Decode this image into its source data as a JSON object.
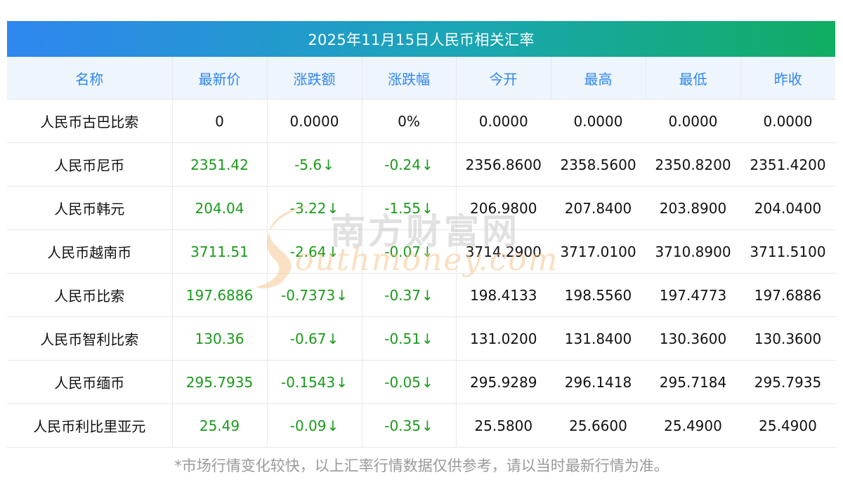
{
  "title": "2025年11月15日人民币相关汇率",
  "columns": [
    "名称",
    "最新价",
    "涨跌额",
    "涨跌幅",
    "今开",
    "最高",
    "最低",
    "昨收"
  ],
  "rows": [
    {
      "name": "人民币古巴比索",
      "latest": "0",
      "change": "0.0000",
      "pct": "0%",
      "open": "0.0000",
      "high": "0.0000",
      "low": "0.0000",
      "prev": "0.0000",
      "down": false
    },
    {
      "name": "人民币尼币",
      "latest": "2351.42",
      "change": "-5.6",
      "pct": "-0.24",
      "open": "2356.8600",
      "high": "2358.5600",
      "low": "2350.8200",
      "prev": "2351.4200",
      "down": true
    },
    {
      "name": "人民币韩元",
      "latest": "204.04",
      "change": "-3.22",
      "pct": "-1.55",
      "open": "206.9800",
      "high": "207.8400",
      "low": "203.8900",
      "prev": "204.0400",
      "down": true
    },
    {
      "name": "人民币越南币",
      "latest": "3711.51",
      "change": "-2.64",
      "pct": "-0.07",
      "open": "3714.2900",
      "high": "3717.0100",
      "low": "3710.8900",
      "prev": "3711.5100",
      "down": true
    },
    {
      "name": "人民币比索",
      "latest": "197.6886",
      "change": "-0.7373",
      "pct": "-0.37",
      "open": "198.4133",
      "high": "198.5560",
      "low": "197.4773",
      "prev": "197.6886",
      "down": true
    },
    {
      "name": "人民币智利比索",
      "latest": "130.36",
      "change": "-0.67",
      "pct": "-0.51",
      "open": "131.0200",
      "high": "131.8400",
      "low": "130.3600",
      "prev": "130.3600",
      "down": true
    },
    {
      "name": "人民币缅币",
      "latest": "295.7935",
      "change": "-0.1543",
      "pct": "-0.05",
      "open": "295.9289",
      "high": "296.1418",
      "low": "295.7184",
      "prev": "295.7935",
      "down": true
    },
    {
      "name": "人民币利比里亚元",
      "latest": "25.49",
      "change": "-0.09",
      "pct": "-0.35",
      "open": "25.5800",
      "high": "25.6600",
      "low": "25.4900",
      "prev": "25.4900",
      "down": true
    }
  ],
  "down_arrow": "↓",
  "footnote": "*市场行情变化较快，以上汇率行情数据仅供参考，请以当时最新行情为准。",
  "watermark": {
    "cn": "南方财富网",
    "en": "outhmoney.com"
  },
  "colors": {
    "header_text": "#2f86f0",
    "down": "#1a9a1a",
    "title_start": "#2f86f0",
    "title_end": "#10ad62"
  }
}
